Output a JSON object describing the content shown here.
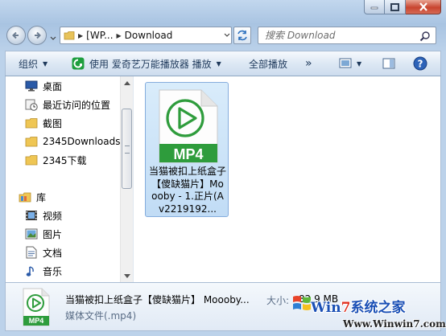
{
  "window": {
    "caption_buttons": [
      "minimize",
      "maximize",
      "close"
    ]
  },
  "address": {
    "crumbs": [
      "[WP...",
      "Download"
    ],
    "search_placeholder": "搜索 Download"
  },
  "toolbar": {
    "organize": "组织",
    "play_with": "使用 爱奇艺万能播放器 播放",
    "play_all": "全部播放",
    "more": "»"
  },
  "nav": {
    "favorites": [
      {
        "label": "桌面",
        "icon": "desktop-icon"
      },
      {
        "label": "最近访问的位置",
        "icon": "recent-places-icon"
      },
      {
        "label": "截图",
        "icon": "folder-icon"
      },
      {
        "label": "2345Downloads",
        "icon": "folder-icon"
      },
      {
        "label": "2345下载",
        "icon": "folder-icon"
      }
    ],
    "libraries_label": "库",
    "libraries": [
      {
        "label": "视频",
        "icon": "video-library-icon"
      },
      {
        "label": "图片",
        "icon": "picture-library-icon"
      },
      {
        "label": "文档",
        "icon": "document-library-icon"
      },
      {
        "label": "音乐",
        "icon": "music-library-icon"
      }
    ]
  },
  "file": {
    "name": "当猫被扣上纸盒子【傻缺猫片】Moooby - 1.正片(Av2219192...",
    "badge": "MP4"
  },
  "details": {
    "name": "当猫被扣上纸盒子【傻缺猫片】 Moooby...",
    "size_label": "大小:",
    "size": "82.9 MB",
    "type": "媒体文件(.mp4)",
    "badge": "MP4"
  },
  "watermark": {
    "main_pre": "Win",
    "main_seven": "7",
    "main_post": "系统之家",
    "sub": "Www.Winwin7.com"
  },
  "colors": {
    "mp4_green": "#2e9c3c",
    "selection": "#c7e0f7",
    "toolbar_text": "#1e395b"
  }
}
